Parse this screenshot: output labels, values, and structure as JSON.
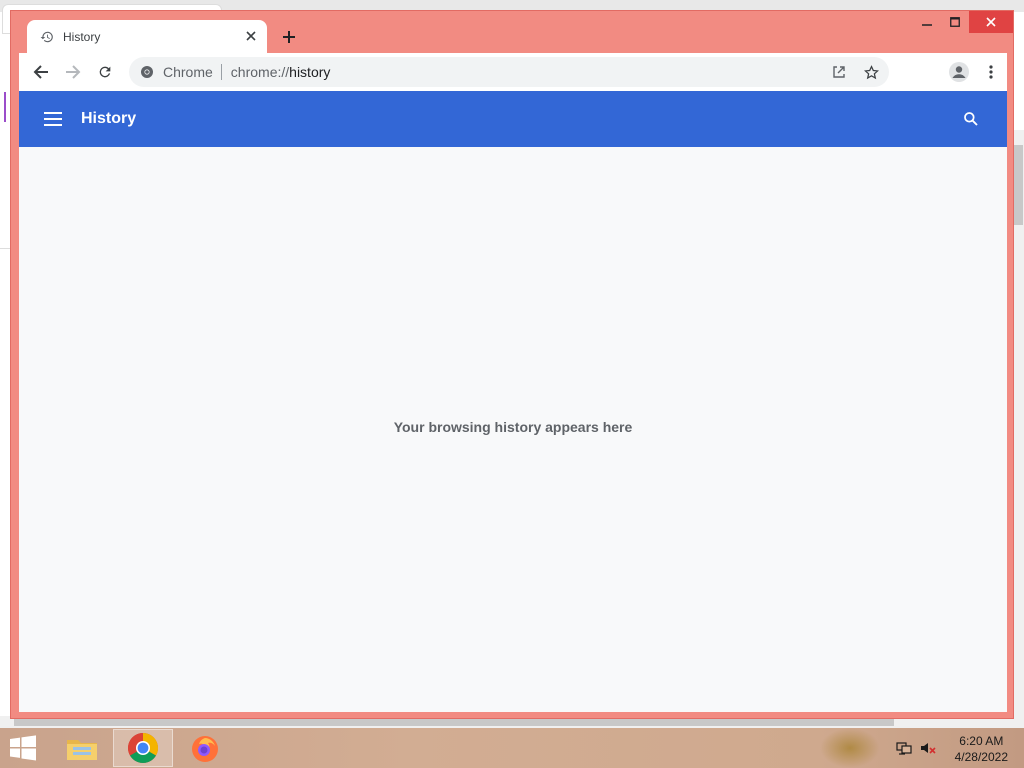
{
  "browser": {
    "tab": {
      "title": "History"
    },
    "omnibox": {
      "chip": "Chrome",
      "url_scheme": "chrome://",
      "url_host": "history"
    }
  },
  "page": {
    "appbar_title": "History",
    "empty_message": "Your browsing history appears here"
  },
  "taskbar": {
    "time": "6:20 AM",
    "date": "4/28/2022"
  },
  "colors": {
    "window_frame": "#f28b82",
    "appbar": "#3367d6",
    "page_background": "#f8f9fa",
    "close_button": "#e04343"
  }
}
